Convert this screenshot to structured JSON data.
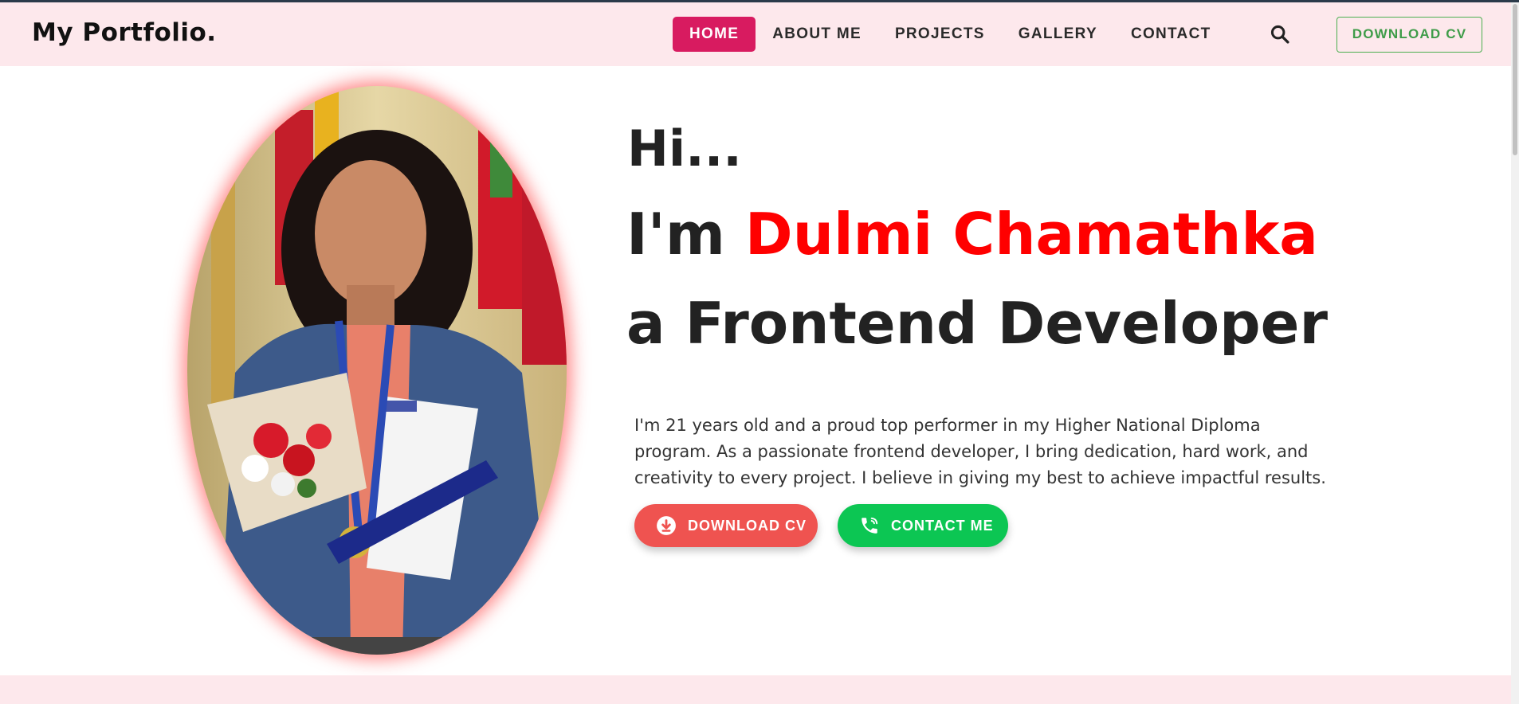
{
  "navbar": {
    "brand": "My Portfolio.",
    "items": [
      {
        "label": "HOME",
        "active": true
      },
      {
        "label": "ABOUT ME",
        "active": false
      },
      {
        "label": "PROJECTS",
        "active": false
      },
      {
        "label": "GALLERY",
        "active": false
      },
      {
        "label": "CONTACT",
        "active": false
      }
    ],
    "search_icon": "search-icon",
    "download_cv_label": "DOWNLOAD CV"
  },
  "hero": {
    "greeting": "Hi...",
    "intro_prefix": "I'm ",
    "name": "Dulmi Chamathka",
    "role": "a Frontend Developer",
    "description": "I'm 21 years old and a proud top performer in my Higher National Diploma program. As a passionate frontend developer, I bring dedication, hard work, and creativity to every project. I believe in giving my best to achieve impactful results.",
    "buttons": {
      "download_label": "DOWNLOAD CV",
      "download_icon": "download-circle-icon",
      "contact_label": "CONTACT ME",
      "contact_icon": "phone-icon"
    }
  },
  "colors": {
    "navbar_bg": "#fde8ec",
    "active_nav": "#d81b60",
    "name_accent": "#ff0000",
    "download_btn": "#ef5350",
    "contact_btn": "#0cc653",
    "outline_btn": "#4caf50"
  }
}
